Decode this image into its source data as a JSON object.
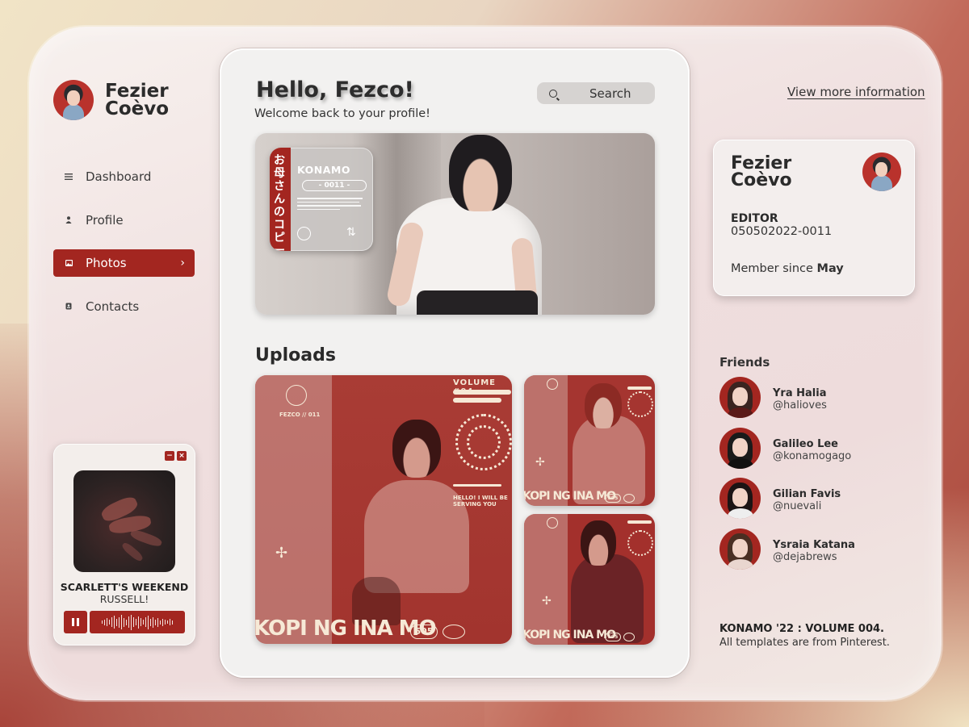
{
  "user": {
    "first_name": "Fezier",
    "last_name": "Coèvo"
  },
  "sidebar": {
    "items": [
      {
        "label": "Dashboard",
        "icon": "list-icon"
      },
      {
        "label": "Profile",
        "icon": "person-icon"
      },
      {
        "label": "Photos",
        "icon": "photo-icon",
        "active": true
      },
      {
        "label": "Contacts",
        "icon": "contacts-icon"
      }
    ],
    "active_chevron": "›"
  },
  "player": {
    "minimize": "−",
    "close": "×",
    "song_title": "SCARLETT'S WEEKEND",
    "artist": "RUSSELL!"
  },
  "main": {
    "greeting": "Hello, Fezco!",
    "welcome": "Welcome back to your profile!",
    "search_label": "Search",
    "hero_ticket": {
      "vertical_text": "お母さんのコピー",
      "title": "KONAMO",
      "code": "- 0011 -"
    },
    "uploads_title": "Uploads",
    "uploads": [
      {
        "caption": "KOPI NG INA MO",
        "badge": "505",
        "volume": "VOLUME #04",
        "tag": "FEZCO // 011"
      },
      {
        "caption": "KOPI NG INA MO",
        "badge": "505"
      },
      {
        "caption": "KOPI NG INA MO",
        "badge": "505"
      }
    ]
  },
  "right": {
    "view_more": "View more information",
    "card": {
      "role": "EDITOR",
      "id_number": "050502022-0011",
      "member_since_prefix": "Member since ",
      "member_since_value": "May"
    },
    "friends_title": "Friends",
    "friends": [
      {
        "name": "Yra Halia",
        "handle": "@halioves"
      },
      {
        "name": "Galileo Lee",
        "handle": "@konamogago"
      },
      {
        "name": "Gilian Favis",
        "handle": "@nuevali"
      },
      {
        "name": "Ysraia Katana",
        "handle": "@dejabrews"
      }
    ],
    "footer_title": "KONAMO '22 : VOLUME 004.",
    "footer_note": "All templates are from Pinterest."
  },
  "colors": {
    "accent": "#a32620",
    "background_light": "#f2f1f0",
    "text_dark": "#2b2b2b"
  }
}
